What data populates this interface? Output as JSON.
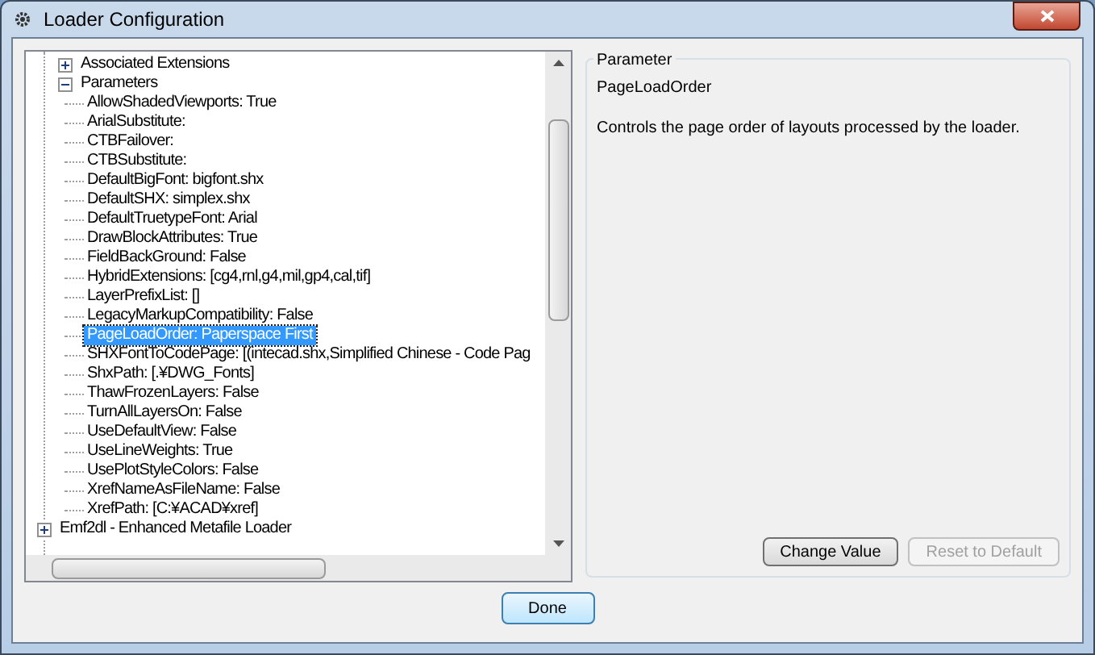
{
  "window": {
    "title": "Loader Configuration"
  },
  "tree": {
    "items": [
      {
        "label": "Associated Extensions",
        "expanded": false,
        "selected": false
      },
      {
        "label": "Parameters",
        "expanded": true,
        "selected": false,
        "children": [
          {
            "label": "AllowShadedViewports: True",
            "selected": false
          },
          {
            "label": "ArialSubstitute:",
            "selected": false
          },
          {
            "label": "CTBFailover:",
            "selected": false
          },
          {
            "label": "CTBSubstitute:",
            "selected": false
          },
          {
            "label": "DefaultBigFont: bigfont.shx",
            "selected": false
          },
          {
            "label": "DefaultSHX: simplex.shx",
            "selected": false
          },
          {
            "label": "DefaultTruetypeFont: Arial",
            "selected": false
          },
          {
            "label": "DrawBlockAttributes: True",
            "selected": false
          },
          {
            "label": "FieldBackGround: False",
            "selected": false
          },
          {
            "label": "HybridExtensions: [cg4,rnl,g4,mil,gp4,cal,tif]",
            "selected": false
          },
          {
            "label": "LayerPrefixList: []",
            "selected": false
          },
          {
            "label": "LegacyMarkupCompatibility: False",
            "selected": false
          },
          {
            "label": "PageLoadOrder: Paperspace First",
            "selected": true
          },
          {
            "label": "SHXFontToCodePage: [(intecad.shx,Simplified Chinese - Code Pag",
            "selected": false
          },
          {
            "label": "ShxPath: [.¥DWG_Fonts]",
            "selected": false
          },
          {
            "label": "ThawFrozenLayers: False",
            "selected": false
          },
          {
            "label": "TurnAllLayersOn: False",
            "selected": false
          },
          {
            "label": "UseDefaultView: False",
            "selected": false
          },
          {
            "label": "UseLineWeights: True",
            "selected": false
          },
          {
            "label": "UsePlotStyleColors: False",
            "selected": false
          },
          {
            "label": "XrefNameAsFileName: False",
            "selected": false
          },
          {
            "label": "XrefPath: [C:¥ACAD¥xref]",
            "selected": false
          }
        ]
      }
    ],
    "outer_items": [
      {
        "label": "Emf2dl - Enhanced Metafile Loader",
        "expanded": false,
        "selected": false
      }
    ]
  },
  "parameter": {
    "legend": "Parameter",
    "name": "PageLoadOrder",
    "description": "Controls the page order of layouts processed by the loader.",
    "buttons": [
      {
        "label": "Change Value",
        "disabled": false
      },
      {
        "label": "Reset to Default",
        "disabled": true
      }
    ]
  },
  "footer": {
    "done": "Done"
  }
}
